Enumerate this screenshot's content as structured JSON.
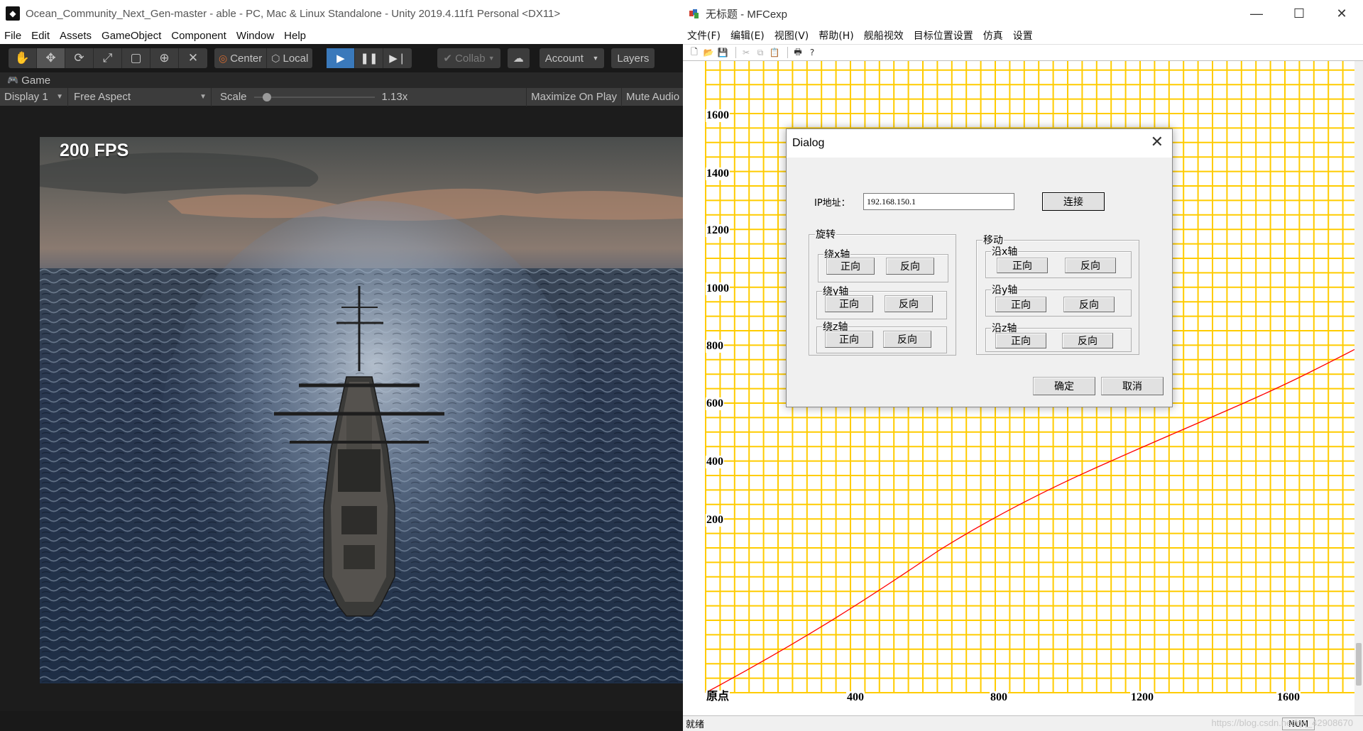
{
  "unity": {
    "title": "Ocean_Community_Next_Gen-master - able - PC, Mac & Linux Standalone - Unity 2019.4.11f1 Personal <DX11>",
    "menu": [
      "File",
      "Edit",
      "Assets",
      "GameObject",
      "Component",
      "Window",
      "Help"
    ],
    "toolbar": {
      "pivot_label": "Center",
      "space_label": "Local",
      "collab_label": "Collab",
      "account_label": "Account",
      "layers_label": "Layers"
    },
    "game_tab": "Game",
    "gamebar": {
      "display": "Display 1",
      "aspect": "Free Aspect",
      "scale_label": "Scale",
      "scale_value": "1.13x",
      "scale_fraction": 0.05,
      "maximize": "Maximize On Play",
      "mute": "Mute Audio"
    },
    "fps": "200 FPS"
  },
  "mfc": {
    "title": "无标题 - MFCexp",
    "menu": [
      "文件(F)",
      "编辑(E)",
      "视图(V)",
      "帮助(H)",
      "舰船视效",
      "目标位置设置",
      "仿真",
      "设置"
    ],
    "status_text": "就绪",
    "status_num": "NUM",
    "watermark": "https://blog.csdn.net/qq_42908670",
    "plot": {
      "origin_label": "原点",
      "x_ticks": [
        "400",
        "800",
        "1200",
        "1600"
      ],
      "y_ticks": [
        "1600",
        "1400",
        "1200",
        "1000",
        "800",
        "600",
        "400",
        "200"
      ],
      "grid_color": "#ffcc00",
      "line_color": "#ff0000"
    },
    "dialog": {
      "title": "Dialog",
      "ip_label": "IP地址：",
      "ip_value": "192.168.150.1",
      "connect": "连接",
      "rotate_group": "旋转",
      "move_group": "移动",
      "rot_x": "绕x轴",
      "rot_y": "绕y轴",
      "rot_z": "绕z轴",
      "mov_x": "沿x轴",
      "mov_y": "沿y轴",
      "mov_z": "沿z轴",
      "forward": "正向",
      "reverse": "反向",
      "ok": "确定",
      "cancel": "取消"
    }
  }
}
